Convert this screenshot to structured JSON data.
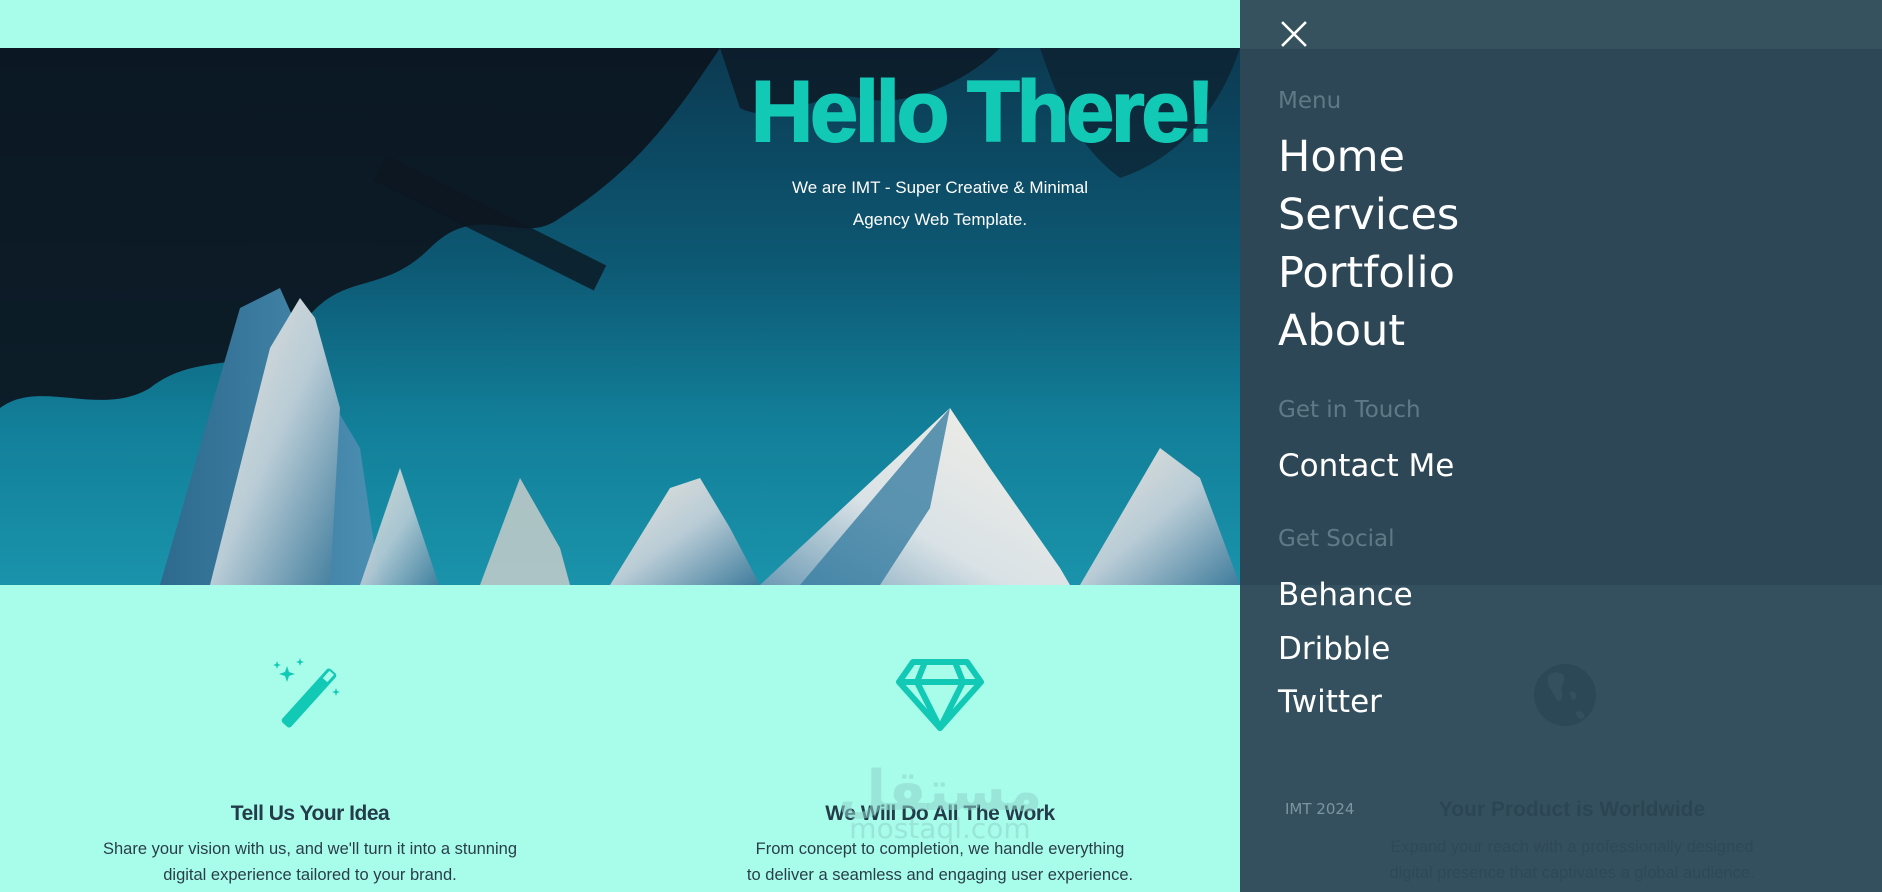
{
  "hero": {
    "title": "Hello There!",
    "subtitle_line1": "We are IMT - Super Creative & Minimal",
    "subtitle_line2": "Agency Web Template.",
    "background_image": "mountain-pine-landscape"
  },
  "features": [
    {
      "icon": "magic-wand-icon",
      "title": "Tell Us Your Idea",
      "desc_line1": "Share your vision with us, and we'll turn it into a stunning",
      "desc_line2": "digital experience tailored to your brand."
    },
    {
      "icon": "diamond-icon",
      "title": "We Will Do All The Work",
      "desc_line1": "From concept to completion, we handle everything",
      "desc_line2": "to deliver a seamless and engaging user experience."
    },
    {
      "icon": "globe-icon",
      "title": "Your Product is Worldwide",
      "desc_line1": "Expand your reach with a professionally designed",
      "desc_line2": "digital presence that captivates a global audience."
    }
  ],
  "watermark": {
    "arabic": "مستقل",
    "latin": "mostaql.com"
  },
  "menu": {
    "close_icon": "close-icon",
    "menu_label": "Menu",
    "nav_items": [
      "Home",
      "Services",
      "Portfolio",
      "About"
    ],
    "touch_label": "Get in Touch",
    "contact_item": "Contact Me",
    "social_label": "Get Social",
    "social_items": [
      "Behance",
      "Dribble",
      "Twitter"
    ],
    "copyright": "IMT 2024"
  },
  "colors": {
    "accent": "#12c9b6",
    "page_bg": "#a8fdea",
    "panel_bg": "#34505e",
    "heading_dark": "#243b4a",
    "muted_label": "#5f7a86"
  }
}
